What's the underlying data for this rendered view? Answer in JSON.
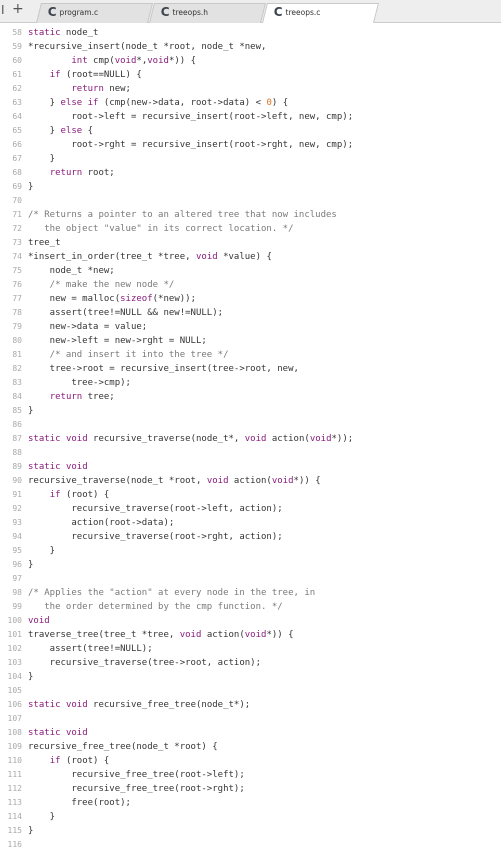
{
  "tabbar": {
    "controls": {
      "left_edge": "I",
      "new_tab": "+"
    },
    "tabs": [
      {
        "label": "program.c",
        "icon": "c-file-icon",
        "active": false
      },
      {
        "label": "treeops.h",
        "icon": "c-file-icon",
        "active": false
      },
      {
        "label": "treeops.c",
        "icon": "c-file-icon",
        "active": true
      }
    ]
  },
  "colors": {
    "keyword": "#8a1c7c",
    "number": "#e07020",
    "comment": "#7a7a7a",
    "text": "#353535",
    "line_number": "#a9a9a9"
  },
  "editor": {
    "lines": [
      {
        "n": "58",
        "text": "static node_t"
      },
      {
        "n": "59",
        "text": "*recursive_insert(node_t *root, node_t *new,"
      },
      {
        "n": "60",
        "text": "        int cmp(void*,void*)) {"
      },
      {
        "n": "61",
        "text": "    if (root==NULL) {"
      },
      {
        "n": "62",
        "text": "        return new;"
      },
      {
        "n": "63",
        "text": "    } else if (cmp(new->data, root->data) < 0) {"
      },
      {
        "n": "64",
        "text": "        root->left = recursive_insert(root->left, new, cmp);"
      },
      {
        "n": "65",
        "text": "    } else {"
      },
      {
        "n": "66",
        "text": "        root->rght = recursive_insert(root->rght, new, cmp);"
      },
      {
        "n": "67",
        "text": "    }"
      },
      {
        "n": "68",
        "text": "    return root;"
      },
      {
        "n": "69",
        "text": "}"
      },
      {
        "n": "70",
        "text": ""
      },
      {
        "n": "71",
        "text": "/* Returns a pointer to an altered tree that now includes"
      },
      {
        "n": "72",
        "text": "   the object \"value\" in its correct location. */"
      },
      {
        "n": "73",
        "text": "tree_t"
      },
      {
        "n": "74",
        "text": "*insert_in_order(tree_t *tree, void *value) {"
      },
      {
        "n": "75",
        "text": "    node_t *new;"
      },
      {
        "n": "76",
        "text": "    /* make the new node */"
      },
      {
        "n": "77",
        "text": "    new = malloc(sizeof(*new));"
      },
      {
        "n": "78",
        "text": "    assert(tree!=NULL && new!=NULL);"
      },
      {
        "n": "79",
        "text": "    new->data = value;"
      },
      {
        "n": "80",
        "text": "    new->left = new->rght = NULL;"
      },
      {
        "n": "81",
        "text": "    /* and insert it into the tree */"
      },
      {
        "n": "82",
        "text": "    tree->root = recursive_insert(tree->root, new,"
      },
      {
        "n": "83",
        "text": "        tree->cmp);"
      },
      {
        "n": "84",
        "text": "    return tree;"
      },
      {
        "n": "85",
        "text": "}"
      },
      {
        "n": "86",
        "text": ""
      },
      {
        "n": "87",
        "text": "static void recursive_traverse(node_t*, void action(void*));"
      },
      {
        "n": "88",
        "text": ""
      },
      {
        "n": "89",
        "text": "static void"
      },
      {
        "n": "90",
        "text": "recursive_traverse(node_t *root, void action(void*)) {"
      },
      {
        "n": "91",
        "text": "    if (root) {"
      },
      {
        "n": "92",
        "text": "        recursive_traverse(root->left, action);"
      },
      {
        "n": "93",
        "text": "        action(root->data);"
      },
      {
        "n": "94",
        "text": "        recursive_traverse(root->rght, action);"
      },
      {
        "n": "95",
        "text": "    }"
      },
      {
        "n": "96",
        "text": "}"
      },
      {
        "n": "97",
        "text": ""
      },
      {
        "n": "98",
        "text": "/* Applies the \"action\" at every node in the tree, in"
      },
      {
        "n": "99",
        "text": "   the order determined by the cmp function. */"
      },
      {
        "n": "100",
        "text": "void"
      },
      {
        "n": "101",
        "text": "traverse_tree(tree_t *tree, void action(void*)) {"
      },
      {
        "n": "102",
        "text": "    assert(tree!=NULL);"
      },
      {
        "n": "103",
        "text": "    recursive_traverse(tree->root, action);"
      },
      {
        "n": "104",
        "text": "}"
      },
      {
        "n": "105",
        "text": ""
      },
      {
        "n": "106",
        "text": "static void recursive_free_tree(node_t*);"
      },
      {
        "n": "107",
        "text": ""
      },
      {
        "n": "108",
        "text": "static void"
      },
      {
        "n": "109",
        "text": "recursive_free_tree(node_t *root) {"
      },
      {
        "n": "110",
        "text": "    if (root) {"
      },
      {
        "n": "111",
        "text": "        recursive_free_tree(root->left);"
      },
      {
        "n": "112",
        "text": "        recursive_free_tree(root->rght);"
      },
      {
        "n": "113",
        "text": "        free(root);"
      },
      {
        "n": "114",
        "text": "    }"
      },
      {
        "n": "115",
        "text": "}"
      },
      {
        "n": "116",
        "text": ""
      }
    ]
  }
}
